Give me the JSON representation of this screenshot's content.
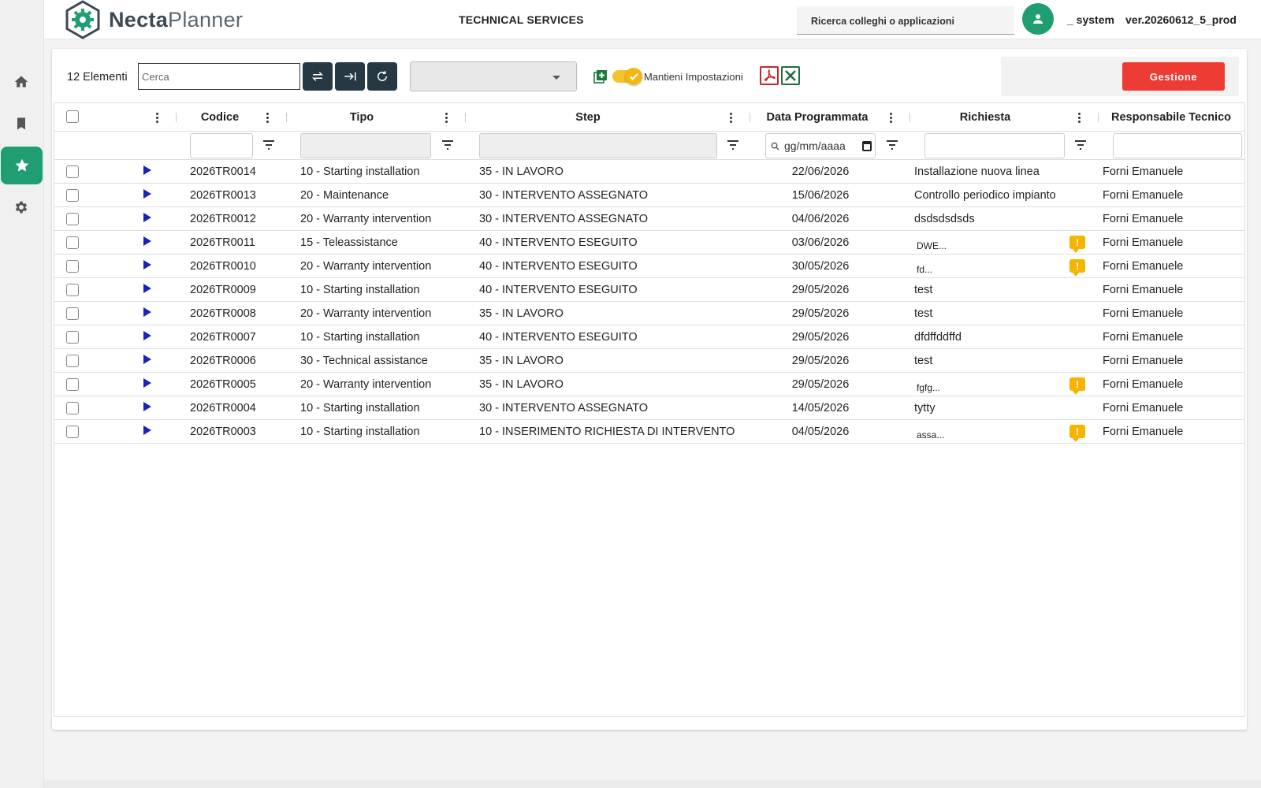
{
  "app": {
    "logo_primary": "Necta",
    "logo_secondary": "Planner",
    "title": "TECHNICAL SERVICES",
    "colleague_search_placeholder": "Ricerca colleghi o applicazioni",
    "user": "_ system",
    "version": "ver.20260612_5_prod"
  },
  "sidebar": {
    "items": [
      {
        "name": "home",
        "icon": "home-icon"
      },
      {
        "name": "bookmarks",
        "icon": "bookmark-icon"
      },
      {
        "name": "favorites",
        "icon": "star-icon",
        "active": true
      },
      {
        "name": "settings",
        "icon": "gear-icon"
      }
    ]
  },
  "toolbar": {
    "count_label": "12 Elementi",
    "search_placeholder": "Cerca",
    "select_value": "",
    "keep_settings_label": "Mantieni Impostazioni",
    "keep_settings_on": true,
    "manage_label": "Gestione"
  },
  "grid": {
    "columns": [
      "Codice",
      "Tipo",
      "Step",
      "Data Programmata",
      "Richiesta",
      "Responsabile Tecnico"
    ],
    "date_filter_placeholder": "gg/mm/aaaa",
    "rows": [
      {
        "code": "2026TR0014",
        "type": "10 - Starting installation",
        "step": "35 - IN LAVORO",
        "date": "22/06/2026",
        "request": "Installazione nuova linea",
        "note": false,
        "tech": "Forni Emanuele"
      },
      {
        "code": "2026TR0013",
        "type": "20 - Maintenance",
        "step": "30 - INTERVENTO ASSEGNATO",
        "date": "15/06/2026",
        "request": "Controllo periodico impianto",
        "note": false,
        "tech": "Forni Emanuele"
      },
      {
        "code": "2026TR0012",
        "type": "20 - Warranty intervention",
        "step": "30 - INTERVENTO ASSEGNATO",
        "date": "04/06/2026",
        "request": "dsdsdsdsds",
        "note": false,
        "tech": "Forni Emanuele"
      },
      {
        "code": "2026TR0011",
        "type": "15 - Teleassistance",
        "step": "40 - INTERVENTO ESEGUITO",
        "date": "03/06/2026",
        "request": "DWE...",
        "note": true,
        "tech": "Forni Emanuele"
      },
      {
        "code": "2026TR0010",
        "type": "20 - Warranty intervention",
        "step": "40 - INTERVENTO ESEGUITO",
        "date": "30/05/2026",
        "request": "fd...",
        "note": true,
        "tech": "Forni Emanuele"
      },
      {
        "code": "2026TR0009",
        "type": "10 - Starting installation",
        "step": "40 - INTERVENTO ESEGUITO",
        "date": "29/05/2026",
        "request": "test",
        "note": false,
        "tech": "Forni Emanuele"
      },
      {
        "code": "2026TR0008",
        "type": "20 - Warranty intervention",
        "step": "35 - IN LAVORO",
        "date": "29/05/2026",
        "request": "test",
        "note": false,
        "tech": "Forni Emanuele"
      },
      {
        "code": "2026TR0007",
        "type": "10 - Starting installation",
        "step": "40 - INTERVENTO ESEGUITO",
        "date": "29/05/2026",
        "request": "dfdffddffd",
        "note": false,
        "tech": "Forni Emanuele"
      },
      {
        "code": "2026TR0006",
        "type": "30 - Technical assistance",
        "step": "35 - IN LAVORO",
        "date": "29/05/2026",
        "request": "test",
        "note": false,
        "tech": "Forni Emanuele"
      },
      {
        "code": "2026TR0005",
        "type": "20 - Warranty intervention",
        "step": "35 - IN LAVORO",
        "date": "29/05/2026",
        "request": "fgfg...",
        "note": true,
        "tech": "Forni Emanuele"
      },
      {
        "code": "2026TR0004",
        "type": "10 - Starting installation",
        "step": "30 - INTERVENTO ASSEGNATO",
        "date": "14/05/2026",
        "request": "tytty",
        "note": false,
        "tech": "Forni Emanuele"
      },
      {
        "code": "2026TR0003",
        "type": "10 - Starting installation",
        "step": "10 - INSERIMENTO RICHIESTA DI INTERVENTO",
        "date": "04/05/2026",
        "request": "assa...",
        "note": true,
        "tech": "Forni Emanuele"
      }
    ]
  },
  "colors": {
    "accent_green": "#1f9e72",
    "manage_red": "#ee3b33",
    "tool_dark": "#253844",
    "play_blue": "#1a23b8",
    "note_yellow": "#f5b400"
  }
}
